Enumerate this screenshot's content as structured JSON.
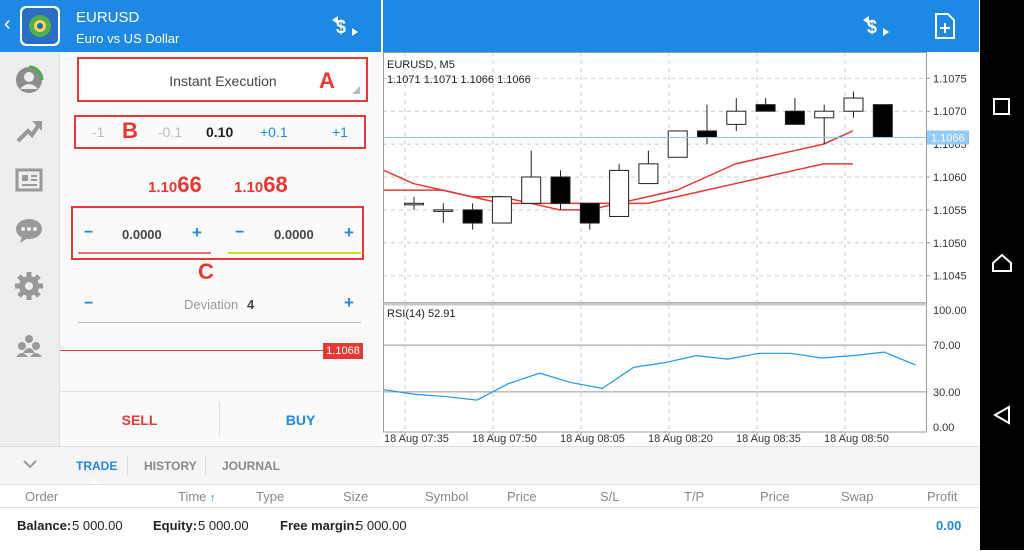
{
  "header": {
    "back_icon": "chevron-left-icon",
    "symbol": "EURUSD",
    "description": "Euro vs US Dollar",
    "left_action_icon": "dollar-swap-icon",
    "right_action_icon": "dollar-swap-icon",
    "new_order_icon": "document-plus-icon",
    "brand_color": "#1e88e5"
  },
  "sidebar": {
    "items": [
      {
        "icon": "account-icon"
      },
      {
        "icon": "trade-arrow-icon"
      },
      {
        "icon": "news-icon"
      },
      {
        "icon": "chat-icon"
      },
      {
        "icon": "settings-icon"
      },
      {
        "icon": "community-icon"
      }
    ]
  },
  "order": {
    "execution_type": "Instant Execution",
    "annotation_a": "A",
    "annotation_b": "B",
    "annotation_c": "C",
    "volume_steps": [
      "-1",
      "-0.1",
      "0.10",
      "+0.1",
      "+1"
    ],
    "bid_prefix": "1.10",
    "bid_big": "66",
    "ask_prefix": "1.10",
    "ask_big": "68",
    "stop_loss": "0.0000",
    "take_profit": "0.0000",
    "minus": "−",
    "plus": "+",
    "deviation_label": "Deviation",
    "deviation_value": "4",
    "ask_line_label": "1.1068",
    "sell_label": "SELL",
    "buy_label": "BUY",
    "sell_color": "#e53935",
    "buy_color": "#1e88e5"
  },
  "chart_data": [
    {
      "type": "candlestick",
      "title": "EURUSD, M5",
      "ohlc_text": "1.1071 1.1071 1.1066 1.1066",
      "y_ticks": [
        "1.1075",
        "1.1070",
        "1.1065",
        "1.1060",
        "1.1055",
        "1.1050",
        "1.1045"
      ],
      "ylim": [
        1.1041,
        1.1079
      ],
      "current_price_label": "1.1066",
      "current_price": 1.1066,
      "candles": [
        {
          "o": 1.1056,
          "h": 1.1057,
          "l": 1.1055,
          "c": 1.1056
        },
        {
          "o": 1.1055,
          "h": 1.1056,
          "l": 1.1053,
          "c": 1.1055
        },
        {
          "o": 1.1055,
          "h": 1.1056,
          "l": 1.1052,
          "c": 1.1053
        },
        {
          "o": 1.1053,
          "h": 1.1057,
          "l": 1.1053,
          "c": 1.1057
        },
        {
          "o": 1.1056,
          "h": 1.1064,
          "l": 1.1056,
          "c": 1.106
        },
        {
          "o": 1.106,
          "h": 1.1061,
          "l": 1.1055,
          "c": 1.1056
        },
        {
          "o": 1.1056,
          "h": 1.1056,
          "l": 1.1052,
          "c": 1.1053
        },
        {
          "o": 1.1054,
          "h": 1.1062,
          "l": 1.1054,
          "c": 1.1061
        },
        {
          "o": 1.1059,
          "h": 1.1064,
          "l": 1.1059,
          "c": 1.1062
        },
        {
          "o": 1.1063,
          "h": 1.1067,
          "l": 1.1063,
          "c": 1.1067
        },
        {
          "o": 1.1067,
          "h": 1.1071,
          "l": 1.1065,
          "c": 1.1066
        },
        {
          "o": 1.1068,
          "h": 1.1072,
          "l": 1.1067,
          "c": 1.107
        },
        {
          "o": 1.1071,
          "h": 1.1072,
          "l": 1.107,
          "c": 1.107
        },
        {
          "o": 1.107,
          "h": 1.1072,
          "l": 1.1068,
          "c": 1.1068
        },
        {
          "o": 1.1069,
          "h": 1.1071,
          "l": 1.1065,
          "c": 1.107
        },
        {
          "o": 1.107,
          "h": 1.1073,
          "l": 1.1069,
          "c": 1.1072
        },
        {
          "o": 1.1071,
          "h": 1.1071,
          "l": 1.1066,
          "c": 1.1066
        }
      ],
      "ma_fast": [
        1.1061,
        1.1059,
        1.1058,
        1.1057,
        1.1056,
        1.1056,
        1.1055,
        1.1055,
        1.1056,
        1.1057,
        1.1058,
        1.106,
        1.1062,
        1.1063,
        1.1064,
        1.1065,
        1.1067
      ],
      "ma_slow": [
        1.1058,
        1.1058,
        1.1058,
        1.1057,
        1.1057,
        1.1056,
        1.1056,
        1.1056,
        1.1056,
        1.1056,
        1.1057,
        1.1058,
        1.1059,
        1.106,
        1.1061,
        1.1062,
        1.1062
      ]
    },
    {
      "type": "line",
      "title": "RSI(14) 52.91",
      "y_ticks": [
        "100.00",
        "70.00",
        "30.00",
        "0.00"
      ],
      "ylim": [
        0,
        100
      ],
      "levels": [
        70,
        30
      ],
      "values": [
        32,
        28,
        26,
        23,
        37,
        46,
        38,
        33,
        51,
        55,
        61,
        58,
        63,
        63,
        59,
        61,
        64,
        53
      ],
      "x_labels": [
        "18 Aug 07:35",
        "18 Aug 07:50",
        "18 Aug 08:05",
        "18 Aug 08:20",
        "18 Aug 08:35",
        "18 Aug 08:50"
      ]
    }
  ],
  "tabs": {
    "collapse_icon": "chevron-down-icon",
    "trade": "TRADE",
    "history": "HISTORY",
    "journal": "JOURNAL"
  },
  "table": {
    "columns": [
      "Order",
      "Time",
      "Type",
      "Size",
      "Symbol",
      "Price",
      "S/L",
      "T/P",
      "Price",
      "Swap",
      "Profit"
    ],
    "sort_icon": "arrow-up-icon"
  },
  "account": {
    "balance_label": "Balance:",
    "balance": "5 000.00",
    "equity_label": "Equity:",
    "equity": "5 000.00",
    "free_margin_label": "Free margin:",
    "free_margin": "5 000.00",
    "profit": "0.00"
  },
  "android": {
    "recent_icon": "square-icon",
    "home_icon": "home-icon",
    "back_icon": "triangle-back-icon"
  }
}
